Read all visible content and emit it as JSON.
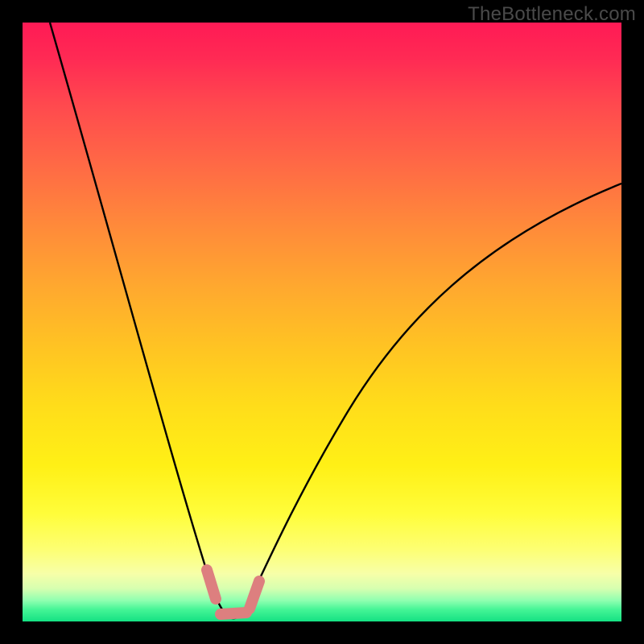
{
  "watermark": "TheBottleneck.com",
  "chart_data": {
    "type": "line",
    "title": "",
    "xlabel": "",
    "ylabel": "",
    "xlim": [
      0,
      100
    ],
    "ylim": [
      0,
      100
    ],
    "series": [
      {
        "name": "bottleneck-curve",
        "x": [
          4,
          6,
          8,
          10,
          12,
          14,
          16,
          18,
          20,
          22,
          24,
          26,
          28,
          30,
          31,
          32,
          33,
          34,
          35,
          36,
          38,
          42,
          46,
          50,
          55,
          60,
          66,
          72,
          80,
          90,
          100
        ],
        "y": [
          100,
          93,
          86,
          79,
          72,
          65,
          58,
          51,
          44,
          37,
          30,
          23,
          17,
          10,
          6,
          3,
          1,
          0.5,
          0.5,
          1,
          4,
          12,
          20,
          28,
          36,
          43,
          50,
          56,
          62,
          68,
          73
        ]
      }
    ],
    "highlight_band": {
      "name": "optimal-range",
      "x_start": 31,
      "x_end": 37,
      "color": "#e07878"
    },
    "gradient_stops": [
      {
        "pos": 0,
        "color": "#ff1a55"
      },
      {
        "pos": 50,
        "color": "#ffc323"
      },
      {
        "pos": 85,
        "color": "#fffd3a"
      },
      {
        "pos": 100,
        "color": "#14e183"
      }
    ]
  }
}
